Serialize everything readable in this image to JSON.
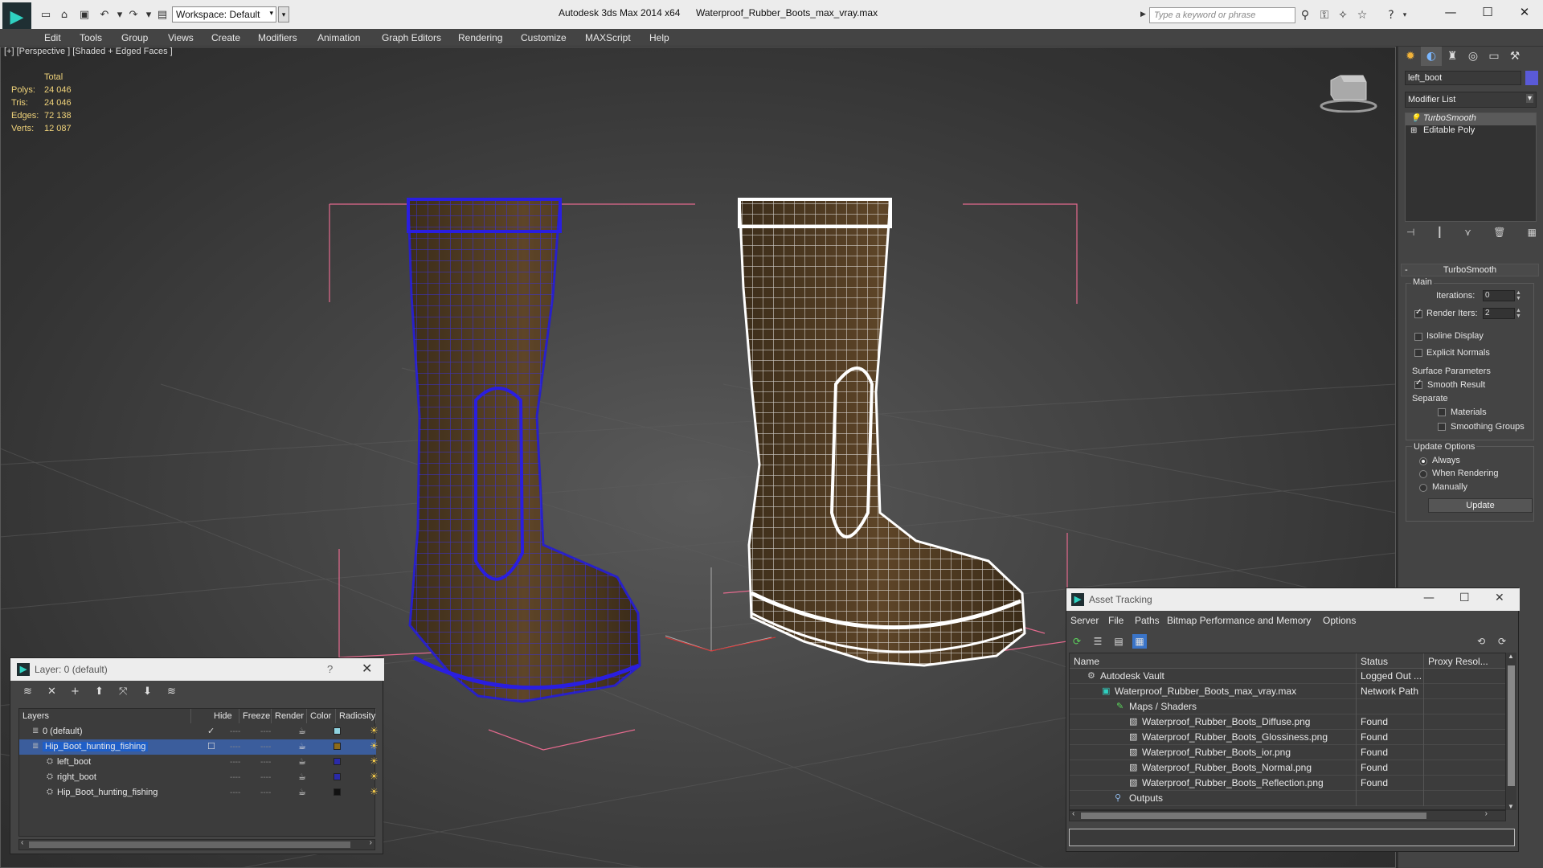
{
  "titlebar": {
    "app_title": "Autodesk 3ds Max  2014 x64",
    "file_title": "Waterproof_Rubber_Boots_max_vray.max",
    "workspace": "Workspace: Default",
    "search_placeholder": "Type a keyword or phrase"
  },
  "menu": [
    "Edit",
    "Tools",
    "Group",
    "Views",
    "Create",
    "Modifiers",
    "Animation",
    "Graph Editors",
    "Rendering",
    "Customize",
    "MAXScript",
    "Help"
  ],
  "viewport": {
    "label": "[+] [Perspective ] [Shaded + Edged Faces ]",
    "stats": {
      "header": "Total",
      "rows": [
        {
          "label": "Polys:",
          "value": "24 046"
        },
        {
          "label": "Tris:",
          "value": "24 046"
        },
        {
          "label": "Edges:",
          "value": "72 138"
        },
        {
          "label": "Verts:",
          "value": "12 087"
        }
      ]
    }
  },
  "command_panel": {
    "object_name": "left_boot",
    "object_color": "#5a5ad8",
    "modifier_list": "Modifier List",
    "stack": [
      {
        "label": "TurboSmooth",
        "selected": true
      },
      {
        "label": "Editable Poly",
        "selected": false
      }
    ],
    "turbosmooth": {
      "title": "TurboSmooth",
      "main_label": "Main",
      "iterations_label": "Iterations:",
      "iterations_value": "0",
      "render_iters_label": "Render Iters:",
      "render_iters_value": "2",
      "render_iters_checked": true,
      "isoline_label": "Isoline Display",
      "explicit_normals_label": "Explicit Normals",
      "surface_params_label": "Surface Parameters",
      "smooth_result_label": "Smooth Result",
      "separate_label": "Separate",
      "materials_label": "Materials",
      "smoothing_groups_label": "Smoothing Groups",
      "update_options_label": "Update Options",
      "always_label": "Always",
      "when_rendering_label": "When Rendering",
      "manually_label": "Manually",
      "update_button": "Update"
    }
  },
  "layer_dialog": {
    "title": "Layer: 0 (default)",
    "help": "?",
    "columns": [
      "Layers",
      "Hide",
      "Freeze",
      "Render",
      "Color",
      "Radiosity"
    ],
    "rows": [
      {
        "name": "0 (default)",
        "color": "#8fd3e0"
      },
      {
        "name": "Hip_Boot_hunting_fishing",
        "color": "#8c6a1a"
      },
      {
        "name": "left_boot",
        "color": "#2a2aa8"
      },
      {
        "name": "right_boot",
        "color": "#2a2aa8"
      },
      {
        "name": "Hip_Boot_hunting_fishing",
        "color": "#111111"
      }
    ]
  },
  "asset_tracking": {
    "title": "Asset Tracking",
    "menu": [
      "Server",
      "File",
      "Paths",
      "Bitmap Performance and Memory",
      "Options"
    ],
    "columns": [
      "Name",
      "Status",
      "Proxy Resol..."
    ],
    "rows": [
      {
        "name": "Autodesk Vault",
        "status": "Logged Out ..."
      },
      {
        "name": "Waterproof_Rubber_Boots_max_vray.max",
        "status": "Network Path"
      },
      {
        "name": "Maps / Shaders",
        "status": ""
      },
      {
        "name": "Waterproof_Rubber_Boots_Diffuse.png",
        "status": "Found"
      },
      {
        "name": "Waterproof_Rubber_Boots_Glossiness.png",
        "status": "Found"
      },
      {
        "name": "Waterproof_Rubber_Boots_ior.png",
        "status": "Found"
      },
      {
        "name": "Waterproof_Rubber_Boots_Normal.png",
        "status": "Found"
      },
      {
        "name": "Waterproof_Rubber_Boots_Reflection.png",
        "status": "Found"
      },
      {
        "name": "Outputs",
        "status": ""
      }
    ]
  }
}
